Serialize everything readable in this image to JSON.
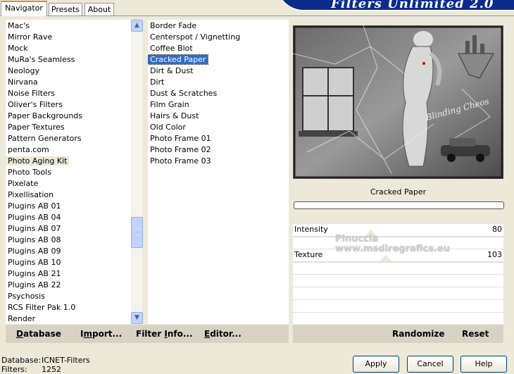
{
  "tabs": [
    "Navigator",
    "Presets",
    "About"
  ],
  "banner_title": "Filters Unlimited 2.0",
  "categories": [
    "Mac's",
    "Mirror Rave",
    "Mock",
    "MuRa's Seamless",
    "Neology",
    "Nirvana",
    "Noise Filters",
    "Oliver's Filters",
    "Paper Backgrounds",
    "Paper Textures",
    "Pattern Generators",
    "penta.com",
    "Photo Aging Kit",
    "Photo Tools",
    "Pixelate",
    "Pixellisation",
    "Plugins AB 01",
    "Plugins AB 04",
    "Plugins AB 07",
    "Plugins AB 08",
    "Plugins AB 09",
    "Plugins AB 10",
    "Plugins AB 21",
    "Plugins AB 22",
    "Psychosis",
    "RCS Filter Pak 1.0",
    "Render"
  ],
  "selected_category": "Photo Aging Kit",
  "filters": [
    "Border Fade",
    "Centerspot / Vignetting",
    "Coffee Blot",
    "Cracked Paper",
    "Dirt & Dust",
    "Dirt",
    "Dust & Scratches",
    "Film Grain",
    "Hairs & Dust",
    "Old Color",
    "Photo Frame 01",
    "Photo Frame 02",
    "Photo Frame 03"
  ],
  "selected_filter": "Cracked Paper",
  "bottom_buttons": {
    "database_u": "D",
    "database_rest": "atabase",
    "import_pre": "I",
    "import_u": "m",
    "import_rest": "port...",
    "filterinfo_pre": "Filter ",
    "filterinfo_u": "I",
    "filterinfo_rest": "nfo...",
    "editor_u": "E",
    "editor_rest": "ditor...",
    "randomize": "Randomize",
    "reset": "Reset"
  },
  "preview_filter_name": "Cracked Paper",
  "preview_watermarks": [
    "Blinding Cheos",
    "Pinuccia",
    "www.msdiregrafics.eu"
  ],
  "params": [
    {
      "label": "Intensity",
      "value": "80",
      "level": 0.31
    },
    {
      "label": "Texture",
      "value": "103",
      "level": 0.4
    }
  ],
  "status": {
    "database_label": "Database:",
    "database_value": "ICNET-Filters",
    "filters_label": "Filters:",
    "filters_value": "1252"
  },
  "actions": {
    "apply": "Apply",
    "cancel": "Cancel",
    "help": "Help"
  },
  "colors": {
    "selection": "#316ac5",
    "banner": "#0a2a8c",
    "tab_accent": "#e68b2c"
  }
}
